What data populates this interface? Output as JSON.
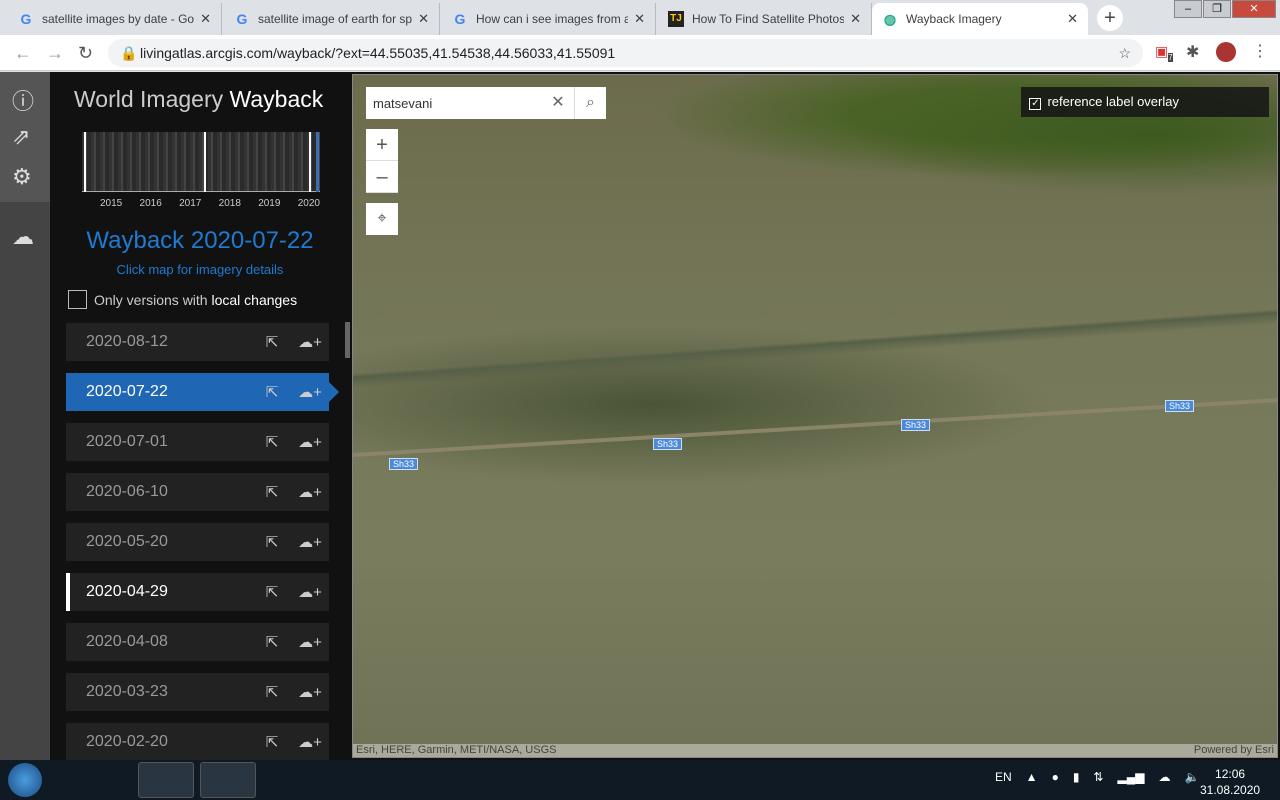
{
  "browser": {
    "tabs": [
      {
        "title": "satellite images by date - Go",
        "icon": "google-icon"
      },
      {
        "title": "satellite image of earth for sp",
        "icon": "google-icon"
      },
      {
        "title": "How can i see images from a",
        "icon": "google-icon"
      },
      {
        "title": "How To Find Satellite Photos",
        "icon": "tj-icon"
      },
      {
        "title": "Wayback Imagery",
        "icon": "arcgis-icon",
        "active": true
      }
    ],
    "url": "livingatlas.arcgis.com/wayback/?ext=44.55035,41.54538,44.56033,41.55091",
    "extension_badge": "7"
  },
  "sidebar": {
    "title_a": "World Imagery",
    "title_b": "Wayback",
    "years": [
      "2015",
      "2016",
      "2017",
      "2018",
      "2019",
      "2020"
    ],
    "selected": "Wayback 2020-07-22",
    "hint": "Click map for imagery details",
    "filter_a": "Only versions with",
    "filter_b": "local changes",
    "filter_checked": false,
    "releases": [
      "2020-08-12",
      "2020-07-22",
      "2020-07-01",
      "2020-06-10",
      "2020-05-20",
      "2020-04-29",
      "2020-04-08",
      "2020-03-23",
      "2020-02-20"
    ]
  },
  "map": {
    "search_value": "matsevani",
    "reference_label": "reference label overlay",
    "reference_checked": true,
    "road_label": "Sh33",
    "attribution": "Esri, HERE, Garmin, METI/NASA, USGS",
    "powered": "Powered by Esri"
  },
  "taskbar": {
    "lang": "EN",
    "time": "12:06",
    "date": "31.08.2020"
  },
  "colors": {
    "accent": "#1f66b5",
    "link": "#1f7bd1"
  }
}
